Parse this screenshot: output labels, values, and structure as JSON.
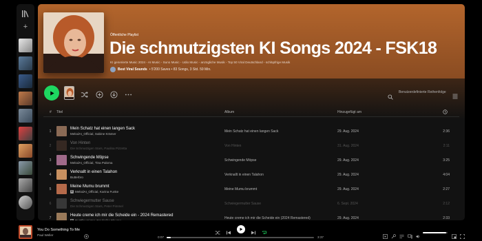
{
  "playlist": {
    "type_label": "Öffentliche Playlist",
    "title": "Die schmutzigsten KI Songs 2024 - FSK18",
    "description": "KI generierte Music 2024 - AI Music - Suno Music - Udio Music - anzügliche Musik - Top 50 Viral Deutschland - schlüpfrige Musik",
    "owner": "Best Viral Sounds",
    "stats": " • 5'200 Saves • 83 Songs, 3 Std. 59 Min."
  },
  "actions": {
    "sort_label": "Benutzerdefinierte Reihenfolge"
  },
  "table": {
    "headers": {
      "num": "#",
      "title": "Titel",
      "album": "Album",
      "added": "Hinzugefügt am"
    },
    "rows": [
      {
        "num": "1",
        "title": "Mein Schatz hat einen langen Sack",
        "artists": "MelodAI_Official, Sabine Krämer",
        "explicit": false,
        "album": "Mein Schatz hat einen langen Sack",
        "added": "29. Aug. 2024",
        "duration": "2:36",
        "dim": false,
        "art_color": "#8a6a55"
      },
      {
        "num": "2",
        "title": "Von Hinten",
        "artists": "Die Schmutzigen Stars, Paulina Pizzetta",
        "explicit": false,
        "album": "Von Hinten",
        "added": "31. Aug. 2024",
        "duration": "2:11",
        "dim": true,
        "art_color": "#6a4a3a"
      },
      {
        "num": "3",
        "title": "Schwingende Möpse",
        "artists": "MelodAI_Official, Tina Paloma",
        "explicit": false,
        "album": "Schwingende Möpse",
        "added": "29. Aug. 2024",
        "duration": "3:25",
        "dim": false,
        "art_color": "#a06a8a"
      },
      {
        "num": "4",
        "title": "Verknallt in einen Talahon",
        "artists": "Butterbro",
        "explicit": false,
        "album": "Verknallt in einen Talahon",
        "added": "29. Aug. 2024",
        "duration": "4:04",
        "dim": false,
        "art_color": "#c89060"
      },
      {
        "num": "5",
        "title": "Meine Mumu brummt",
        "artists": "MelodAI_Official, Karina Funke",
        "explicit": true,
        "album": "Meine Mumu brummt",
        "added": "29. Aug. 2024",
        "duration": "2:27",
        "dim": false,
        "art_color": "#b56a4a"
      },
      {
        "num": "6",
        "title": "Schwiegermutter Sause",
        "artists": "Die Schmutzigen Stars, Peter Pimmel",
        "explicit": false,
        "album": "Schwiegermutter Sause",
        "added": "6. Sept. 2024",
        "duration": "2:12",
        "dim": true,
        "art_color": "#707070"
      },
      {
        "num": "7",
        "title": "Heute creme ich mir die Scheide ein - 2024 Remastered",
        "artists": "Dr Pflaumister, Frederike Flaume",
        "explicit": true,
        "album": "Heute creme ich mir die Scheide ein (2024 Remastered)",
        "added": "29. Aug. 2024",
        "duration": "2:33",
        "dim": false,
        "art_color": "#9a7a5a"
      }
    ]
  },
  "player": {
    "track_title": "You Do Something To Me",
    "track_artist": "Paul Weller",
    "time_current": "0:07",
    "time_total": "3:37",
    "progress": 0.03,
    "volume": 0.95
  },
  "colors": {
    "accent": "#1ed760",
    "hero_top": "#b3652c",
    "background": "#121212"
  }
}
